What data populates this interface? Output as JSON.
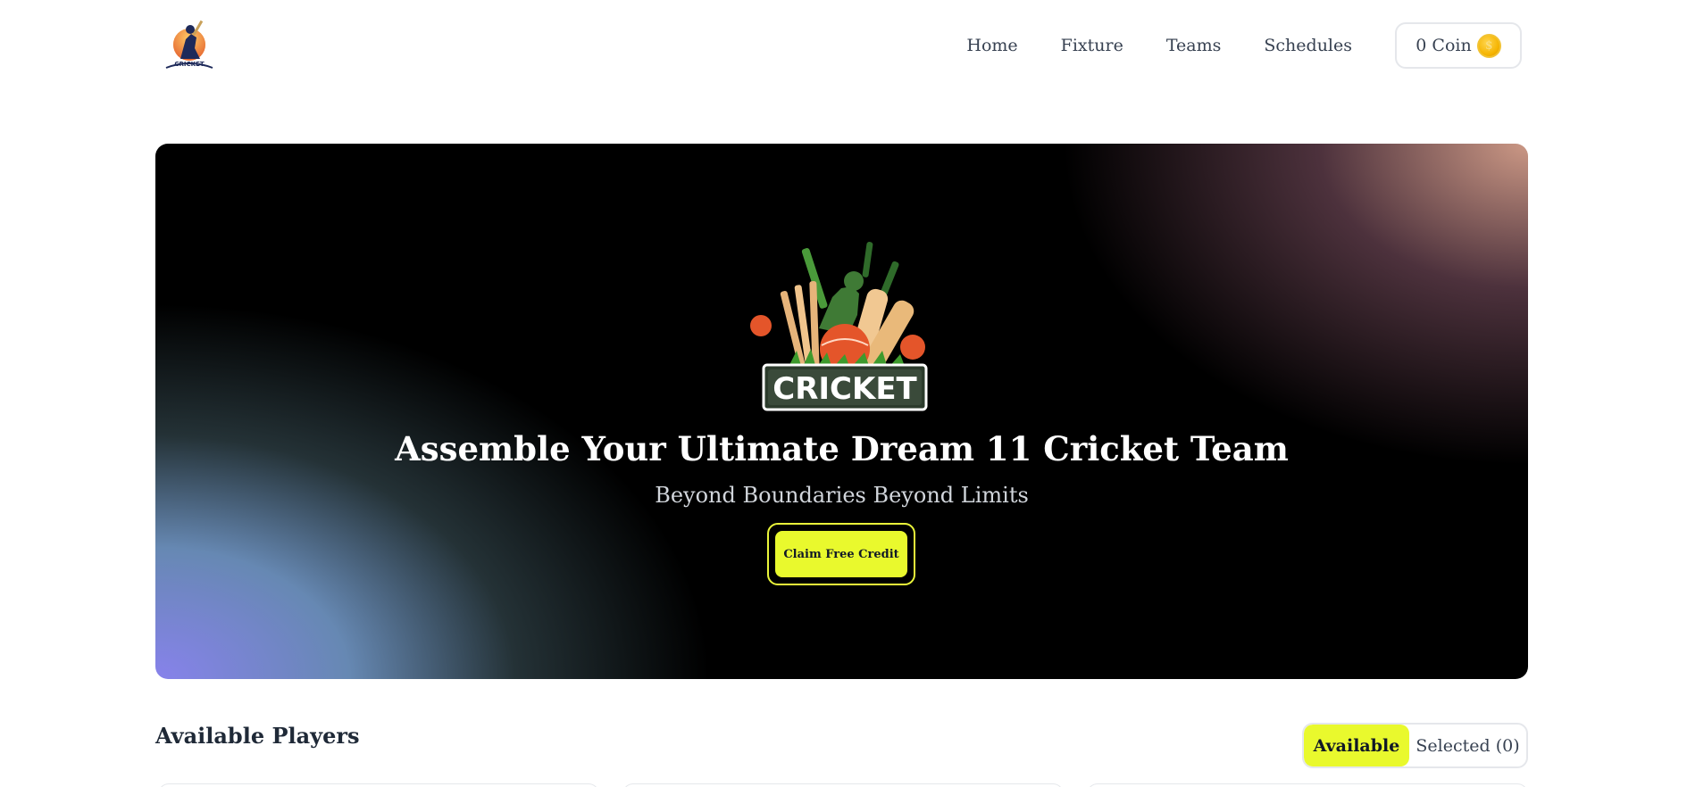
{
  "nav": {
    "logo_text": "CRICKET",
    "links": [
      "Home",
      "Fixture",
      "Teams",
      "Schedules"
    ],
    "coin_label": "0 Coin",
    "coin_icon": "coin-icon"
  },
  "hero": {
    "logo_text": "CRICKET",
    "title": "Assemble Your Ultimate Dream 11 Cricket Team",
    "subtitle": "Beyond Boundaries Beyond Limits",
    "cta_label": "Claim Free Credit"
  },
  "players": {
    "title": "Available Players",
    "toggle_available": "Available",
    "toggle_selected": "Selected (0)"
  },
  "colors": {
    "accent": "#e9f92d",
    "hero_bg": "#000000",
    "text": "#1f2937"
  }
}
